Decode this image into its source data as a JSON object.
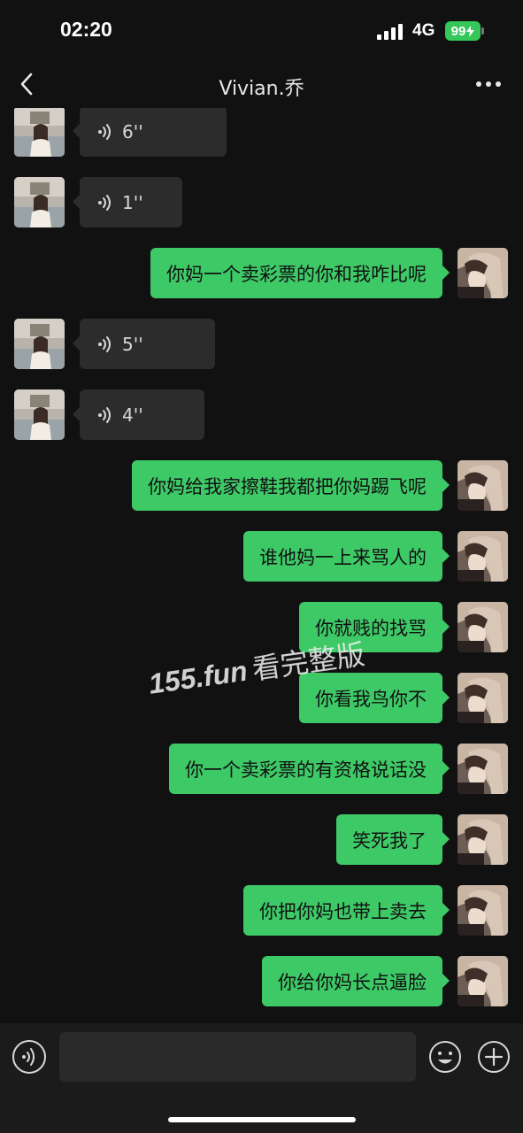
{
  "status_bar": {
    "time": "02:20",
    "network": "4G",
    "battery": "99"
  },
  "nav": {
    "title": "Vivian.乔"
  },
  "messages": [
    {
      "side": "in",
      "type": "voice",
      "duration": "6''"
    },
    {
      "side": "in",
      "type": "voice",
      "duration": "1''"
    },
    {
      "side": "out",
      "type": "text",
      "text": "你妈一个卖彩票的你和我咋比呢"
    },
    {
      "side": "in",
      "type": "voice",
      "duration": "5''"
    },
    {
      "side": "in",
      "type": "voice",
      "duration": "4''"
    },
    {
      "side": "out",
      "type": "text",
      "text": "你妈给我家擦鞋我都把你妈踢飞呢"
    },
    {
      "side": "out",
      "type": "text",
      "text": "谁他妈一上来骂人的"
    },
    {
      "side": "out",
      "type": "text",
      "text": "你就贱的找骂"
    },
    {
      "side": "out",
      "type": "text",
      "text": "你看我鸟你不"
    },
    {
      "side": "out",
      "type": "text",
      "text": "你一个卖彩票的有资格说话没"
    },
    {
      "side": "out",
      "type": "text",
      "text": "笑死我了"
    },
    {
      "side": "out",
      "type": "text",
      "text": "你把你妈也带上卖去"
    },
    {
      "side": "out",
      "type": "text",
      "text": "你给你妈长点逼脸"
    }
  ],
  "watermark": {
    "domain": "155.fun",
    "text": "看完整版"
  },
  "input": {
    "value": ""
  },
  "colors": {
    "outgoing_bubble": "#3ec967",
    "incoming_bubble": "#2c2c2c",
    "background": "#111111",
    "battery": "#35c759"
  }
}
